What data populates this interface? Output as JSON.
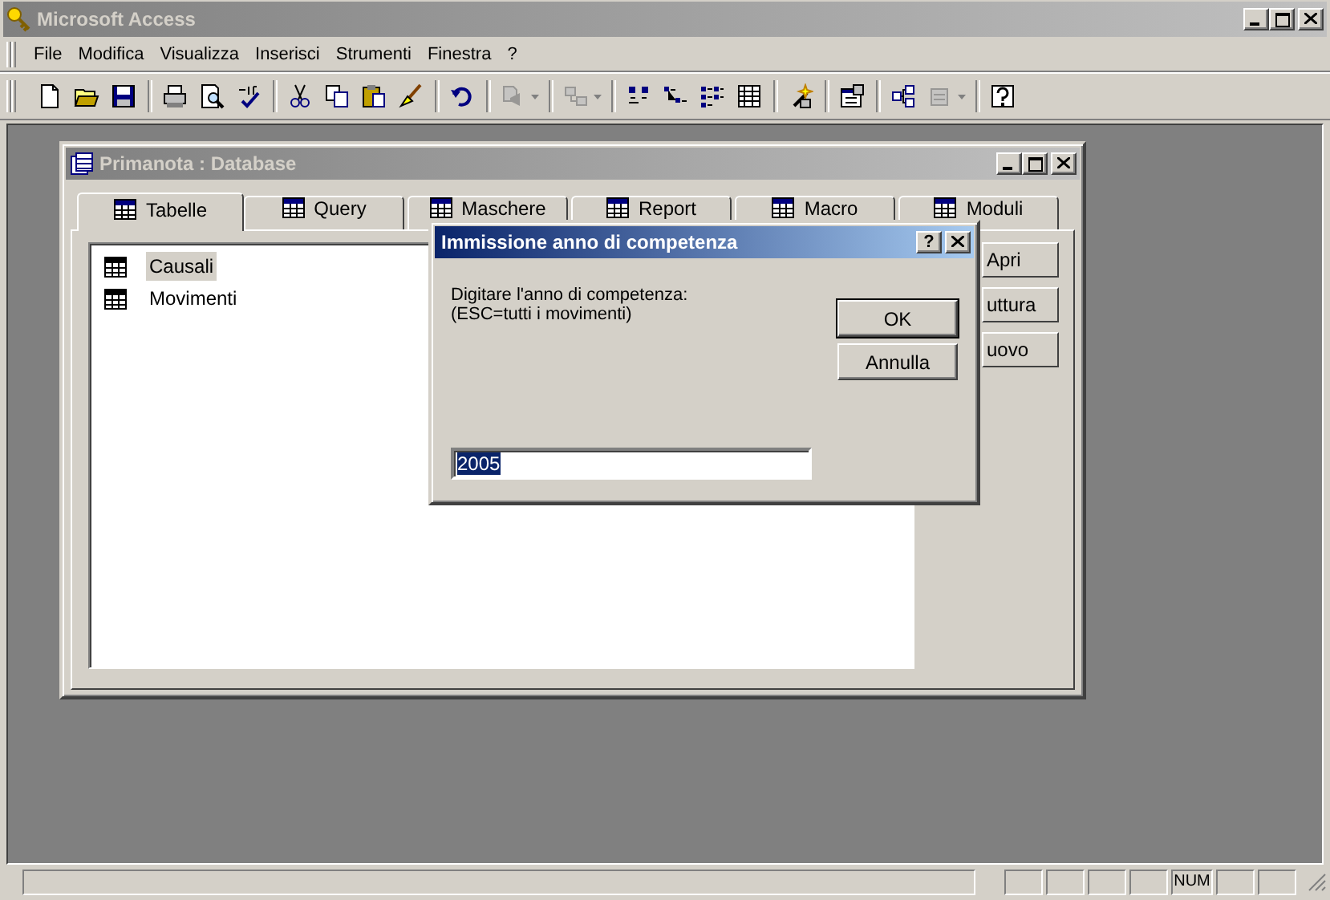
{
  "window": {
    "title": "Microsoft Access"
  },
  "menu": [
    {
      "label": "File"
    },
    {
      "label": "Modifica"
    },
    {
      "label": "Visualizza"
    },
    {
      "label": "Inserisci"
    },
    {
      "label": "Strumenti"
    },
    {
      "label": "Finestra"
    },
    {
      "label": "?"
    }
  ],
  "toolbar": [
    {
      "kind": "button",
      "disabled": false
    },
    {
      "kind": "button",
      "disabled": false
    },
    {
      "kind": "button",
      "disabled": false
    },
    {
      "kind": "separator"
    },
    {
      "kind": "button",
      "disabled": false
    },
    {
      "kind": "button",
      "disabled": false
    },
    {
      "kind": "button",
      "disabled": false
    },
    {
      "kind": "separator"
    },
    {
      "kind": "button",
      "disabled": false
    },
    {
      "kind": "button",
      "disabled": false
    },
    {
      "kind": "button",
      "disabled": false
    },
    {
      "kind": "button",
      "disabled": false
    },
    {
      "kind": "separator"
    },
    {
      "kind": "button",
      "disabled": false
    },
    {
      "kind": "separator"
    },
    {
      "kind": "split",
      "disabled": true
    },
    {
      "kind": "separator"
    },
    {
      "kind": "split",
      "disabled": true
    },
    {
      "kind": "separator"
    },
    {
      "kind": "button",
      "disabled": false
    },
    {
      "kind": "button",
      "disabled": false
    },
    {
      "kind": "button",
      "disabled": false
    },
    {
      "kind": "button",
      "disabled": false
    },
    {
      "kind": "separator"
    },
    {
      "kind": "button",
      "disabled": false
    },
    {
      "kind": "separator"
    },
    {
      "kind": "button",
      "disabled": false
    },
    {
      "kind": "separator"
    },
    {
      "kind": "button",
      "disabled": false
    },
    {
      "kind": "split",
      "disabled": true
    },
    {
      "kind": "separator"
    },
    {
      "kind": "button",
      "disabled": false
    }
  ],
  "database_window": {
    "title": "Primanota : Database",
    "tabs": [
      {
        "label": "Tabelle",
        "selected": true
      },
      {
        "label": "Query",
        "selected": false
      },
      {
        "label": "Maschere",
        "selected": false
      },
      {
        "label": "Report",
        "selected": false
      },
      {
        "label": "Macro",
        "selected": false
      },
      {
        "label": "Moduli",
        "selected": false
      }
    ],
    "items": [
      {
        "label": "Causali",
        "selected": true
      },
      {
        "label": "Movimenti",
        "selected": false
      }
    ],
    "buttons": [
      "Apri",
      "uttura",
      "uovo"
    ]
  },
  "dialog": {
    "title": "Immissione anno di competenza",
    "help_button": "?",
    "prompt": [
      "Digitare l'anno di competenza:",
      "(ESC=tutti i movimenti)"
    ],
    "buttons": [
      {
        "label": "OK",
        "default": true
      },
      {
        "label": "Annulla",
        "default": false
      }
    ],
    "value": "2005"
  },
  "status_bar": {
    "indicator": "NUM"
  }
}
